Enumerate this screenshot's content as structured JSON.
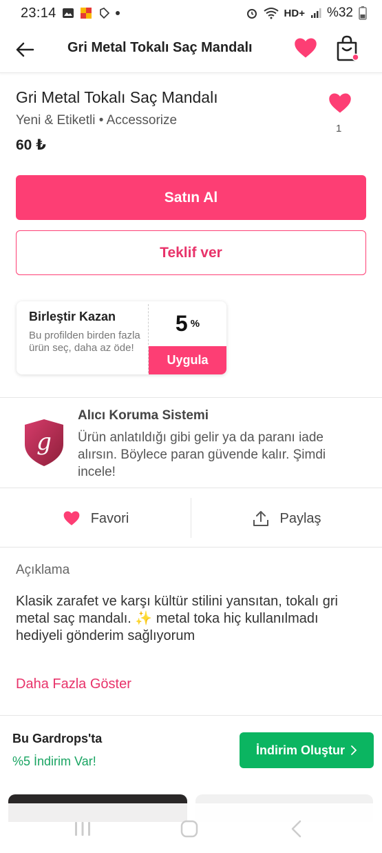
{
  "status_bar": {
    "time": "23:14",
    "network_label": "HD+",
    "battery": "%32"
  },
  "header": {
    "title": "Gri Metal Tokalı Saç Mandalı"
  },
  "product": {
    "title": "Gri Metal Tokalı Saç Mandalı",
    "condition": "Yeni & Etiketli",
    "separator": "•",
    "brand": "Accessorize",
    "price": "60 ₺",
    "like_count": "1"
  },
  "buttons": {
    "buy": "Satın Al",
    "offer": "Teklif ver"
  },
  "coupon": {
    "title": "Birleştir Kazan",
    "description": "Bu profilden birden fazla ürün seç, daha az öde!",
    "percent": "5",
    "percent_sign": "%",
    "apply": "Uygula"
  },
  "protection": {
    "title": "Alıcı Koruma Sistemi",
    "text": "Ürün anlatıldığı gibi gelir ya da paranı iade alırsın. Böylece paran güvende kalır. Şimdi incele!",
    "logo_letter": "g"
  },
  "actions": {
    "favorite": "Favori",
    "share": "Paylaş"
  },
  "description": {
    "label": "Açıklama",
    "text": "Klasik zarafet ve karşı kültür stilini yansıtan, tokalı gri metal saç mandalı. ✨ metal toka hiç kullanılmadı hediyeli gönderim sağlıyorum",
    "more": "Daha Fazla Göster"
  },
  "closet": {
    "title": "Bu Gardrops'ta",
    "discount": "%5 İndirim Var!",
    "create_button": "İndirim Oluştur"
  },
  "colors": {
    "primary_pink": "#fd3e74",
    "green": "#0bb561",
    "green_text": "#19a462"
  },
  "icons": [
    "back-arrow-icon",
    "heart-icon",
    "shopping-bag-icon",
    "share-icon",
    "shield-icon",
    "chevron-right-icon",
    "recent-apps-icon",
    "home-icon",
    "nav-back-icon"
  ]
}
